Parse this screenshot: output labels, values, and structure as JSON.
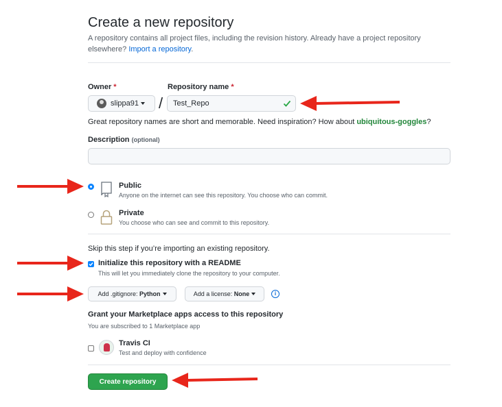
{
  "header": {
    "title": "Create a new repository",
    "subtitle_line1": "A repository contains all project files, including the revision history. Already have a project repository",
    "subtitle_line2_prefix": "elsewhere? ",
    "import_link": "Import a repository",
    "subtitle_line2_suffix": "."
  },
  "owner": {
    "label": "Owner",
    "required_mark": "*",
    "value": "slippa91"
  },
  "separator": "/",
  "repo_name": {
    "label": "Repository name",
    "required_mark": "*",
    "value": "Test_Repo"
  },
  "name_hint": {
    "prefix": "Great repository names are short and memorable. Need inspiration? How about ",
    "suggestion": "ubiquitous-goggles",
    "suffix": "?"
  },
  "description": {
    "label": "Description",
    "optional": "(optional)",
    "value": ""
  },
  "visibility": {
    "public_title": "Public",
    "public_desc": "Anyone on the internet can see this repository. You choose who can commit.",
    "private_title": "Private",
    "private_desc": "You choose who can see and commit to this repository.",
    "selected": "public"
  },
  "init": {
    "skip_text": "Skip this step if you’re importing an existing repository.",
    "readme_label": "Initialize this repository with a README",
    "readme_desc": "This will let you immediately clone the repository to your computer.",
    "readme_checked": true
  },
  "gitignore": {
    "prefix": "Add .gitignore: ",
    "value": "Python"
  },
  "license": {
    "prefix": "Add a license: ",
    "value": "None"
  },
  "info_icon": "i",
  "marketplace": {
    "title": "Grant your Marketplace apps access to this repository",
    "subtitle": "You are subscribed to 1 Marketplace app",
    "app_name": "Travis CI",
    "app_desc": "Test and deploy with confidence",
    "app_checked": false
  },
  "submit_label": "Create repository",
  "colors": {
    "accent_green": "#2ea44f",
    "link_blue": "#0366d6",
    "arrow_red": "#e8261b",
    "required_red": "#cb2431"
  }
}
